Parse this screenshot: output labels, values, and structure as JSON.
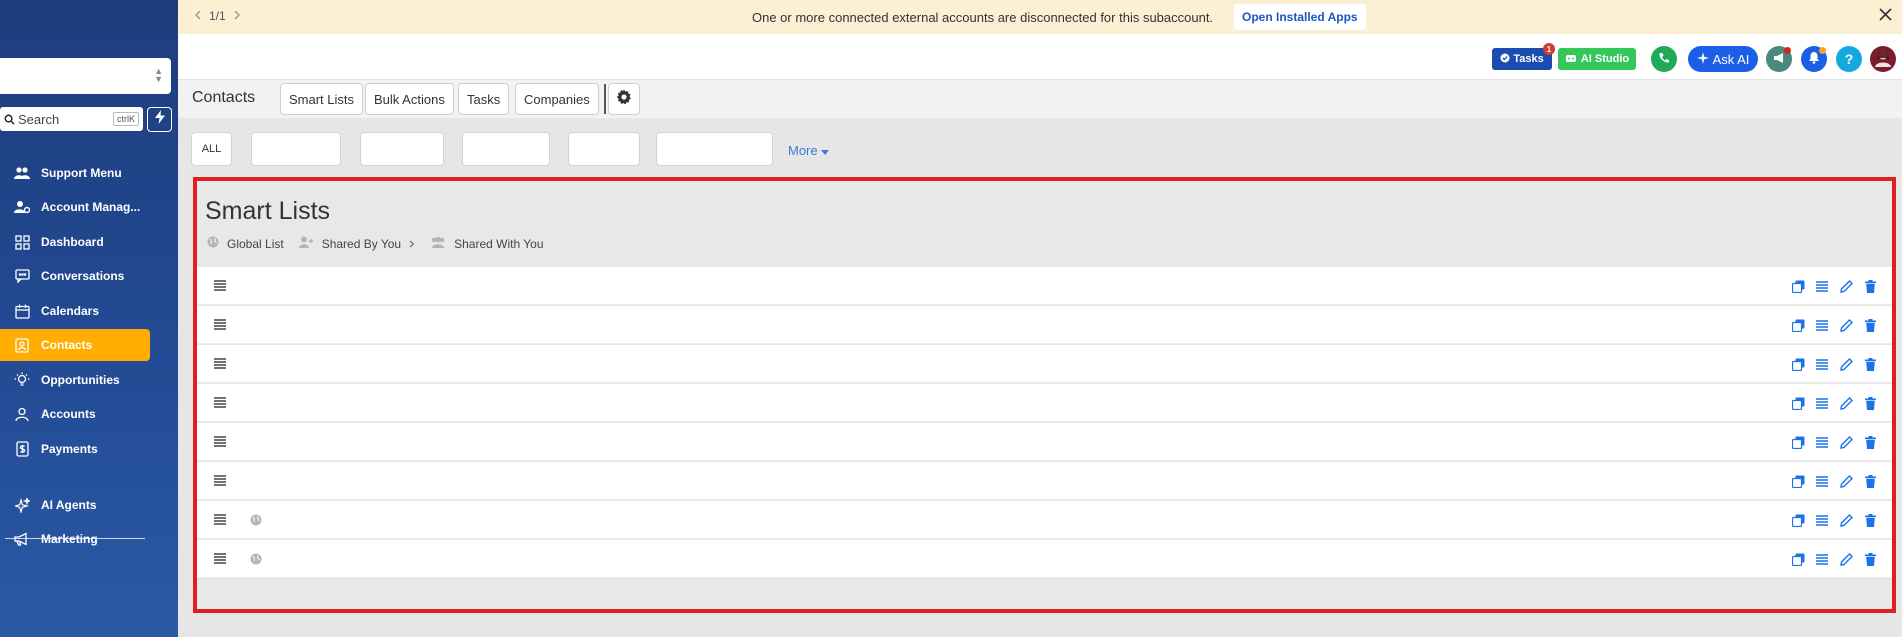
{
  "banner": {
    "pager": "1/1",
    "message": "One or more connected external accounts are disconnected for this subaccount.",
    "button": "Open Installed Apps"
  },
  "search": {
    "label": "Search",
    "shortcut": "ctrlK"
  },
  "sidebar": {
    "items": [
      {
        "label": "Support Menu",
        "icon": "users-icon"
      },
      {
        "label": "Account Manag...",
        "icon": "user-gear-icon"
      },
      {
        "label": "Dashboard",
        "icon": "grid-icon"
      },
      {
        "label": "Conversations",
        "icon": "chat-icon"
      },
      {
        "label": "Calendars",
        "icon": "calendar-icon"
      },
      {
        "label": "Contacts",
        "icon": "contact-book-icon",
        "active": true
      },
      {
        "label": "Opportunities",
        "icon": "lightbulb-icon"
      },
      {
        "label": "Accounts",
        "icon": "person-icon"
      },
      {
        "label": "Payments",
        "icon": "receipt-icon"
      },
      {
        "label": "AI Agents",
        "icon": "sparkle-icon"
      },
      {
        "label": "Marketing",
        "icon": "megaphone-icon"
      }
    ]
  },
  "header": {
    "tasks_label": "Tasks",
    "tasks_badge": "1",
    "ai_studio_label": "AI Studio",
    "ask_ai_label": "Ask AI",
    "help_label": "?"
  },
  "toolbar": {
    "title": "Contacts",
    "tabs": [
      "Smart Lists",
      "Bulk Actions",
      "Tasks",
      "Companies"
    ]
  },
  "filters": {
    "all_label": "ALL",
    "more_label": "More"
  },
  "smart_lists": {
    "title": "Smart Lists",
    "folders": [
      "Global List",
      "Shared By You",
      "Shared With You"
    ],
    "row_count": 8
  },
  "colors": {
    "accent": "#ffad00",
    "primary": "#1b5fe8",
    "highlight_border": "#e0201f",
    "sidebar": "#234a93"
  }
}
